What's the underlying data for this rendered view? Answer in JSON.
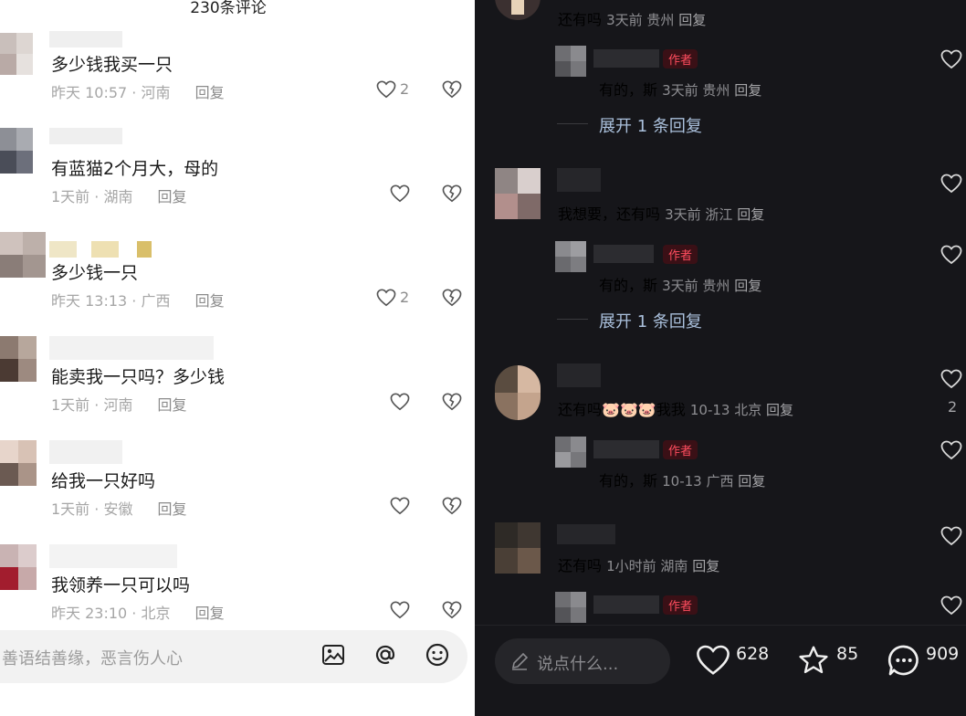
{
  "left": {
    "comment_count": "230条评论",
    "comments": [
      {
        "text": "多少钱我买一只",
        "time": "昨天 10:57 · 河南",
        "reply": "回复",
        "likes": "2"
      },
      {
        "text": "有蓝猫2个月大，母的",
        "time": "1天前 · 湖南",
        "reply": "回复",
        "likes": ""
      },
      {
        "text": "多少钱一只",
        "time": "昨天 13:13 · 广西",
        "reply": "回复",
        "likes": "2"
      },
      {
        "text": "能卖我一只吗？多少钱",
        "time": "1天前 · 河南",
        "reply": "回复",
        "likes": ""
      },
      {
        "text": "给我一只好吗",
        "time": "1天前 · 安徽",
        "reply": "回复",
        "likes": ""
      },
      {
        "text": "我领养一只可以吗",
        "time": "昨天 23:10 · 北京",
        "reply": "回复",
        "likes": ""
      }
    ],
    "input_placeholder": "善语结善缘，恶言伤人心",
    "icons": [
      "image-icon",
      "mention-icon",
      "emoji-icon"
    ]
  },
  "right": {
    "items": [
      {
        "text": "还有吗",
        "meta": "3天前 贵州",
        "reply": "回复"
      },
      {
        "badge": "作者",
        "text": "有的，斯",
        "meta": "3天前 贵州",
        "reply": "回复"
      },
      {
        "expand": "展开 1 条回复"
      },
      {
        "text": "我想要，还有吗",
        "meta": "3天前 浙江",
        "reply": "回复"
      },
      {
        "badge": "作者",
        "text": "有的，斯",
        "meta": "3天前 贵州",
        "reply": "回复"
      },
      {
        "expand": "展开 1 条回复"
      },
      {
        "text": "还有吗",
        "emoji": "🐷🐷🐷",
        "text2": "我我",
        "meta": "10-13 北京",
        "reply": "回复",
        "likes": "2"
      },
      {
        "badge": "作者",
        "text": "有的，斯",
        "meta": "10-13 广西",
        "reply": "回复"
      },
      {
        "text": "还有吗",
        "meta": "1小时前 湖南",
        "reply": "回复"
      },
      {
        "badge": "作者"
      }
    ],
    "say_placeholder": "说点什么...",
    "stats": {
      "likes": "628",
      "favorites": "85",
      "comments": "909"
    }
  },
  "colors": {
    "author_badge": "#ff4d5e",
    "dark_bg": "#16161a",
    "link_blue": "#aac0dc"
  }
}
